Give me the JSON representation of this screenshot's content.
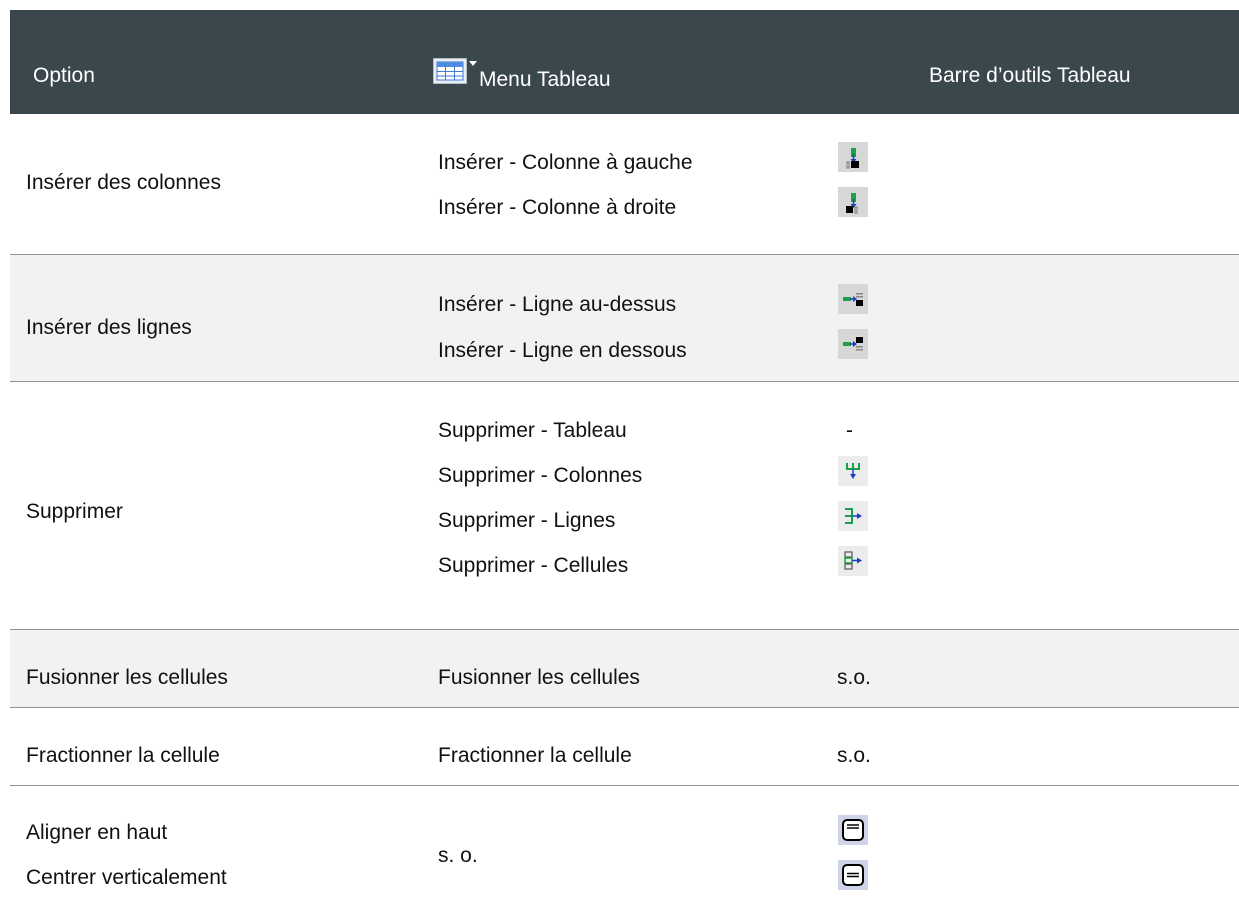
{
  "header": {
    "col1": "Option",
    "col2": "Menu Tableau",
    "col3": "Barre d’outils Tableau"
  },
  "rows": [
    {
      "option": "Insérer des colonnes",
      "menu": [
        "Insérer - Colonne à gauche",
        "Insérer - Colonne à droite"
      ],
      "toolbar_icons": [
        "insert-column-left-icon",
        "insert-column-right-icon"
      ]
    },
    {
      "option": "Insérer des lignes",
      "menu": [
        "Insérer - Ligne au-dessus",
        "Insérer - Ligne en dessous"
      ],
      "toolbar_icons": [
        "insert-row-above-icon",
        "insert-row-below-icon"
      ]
    },
    {
      "option": "Supprimer",
      "menu": [
        "Supprimer - Tableau",
        "Supprimer - Colonnes",
        "Supprimer - Lignes",
        "Supprimer - Cellules"
      ],
      "toolbar_first": "-",
      "toolbar_icons": [
        "delete-columns-icon",
        "delete-rows-icon",
        "delete-cells-icon"
      ]
    },
    {
      "option": "Fusionner les cellules",
      "menu": "Fusionner les cellules",
      "toolbar": "s.o."
    },
    {
      "option": "Fractionner la cellule",
      "menu": "Fractionner la cellule",
      "toolbar": "s.o."
    },
    {
      "options": [
        "Aligner en haut",
        "Centrer verticalement"
      ],
      "menu": "s. o.",
      "toolbar_icons": [
        "align-top-icon",
        "center-vertically-icon"
      ]
    }
  ]
}
